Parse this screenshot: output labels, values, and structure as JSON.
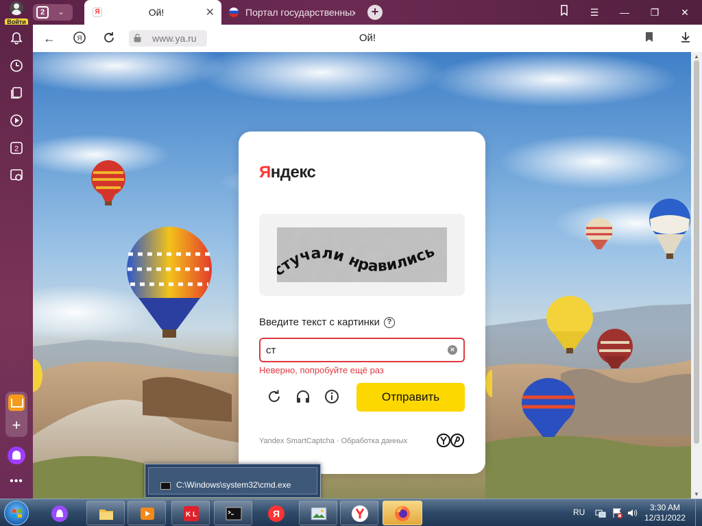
{
  "profile": {
    "login_label": "Войти"
  },
  "tabs": {
    "count": "2",
    "active": {
      "title": "Ой!",
      "favicon_letter": "Я"
    },
    "second": {
      "title": "Портал государственных у"
    }
  },
  "addressbar": {
    "url": "www.ya.ru",
    "page_title": "Ой!"
  },
  "captcha": {
    "brand_first": "Я",
    "brand_rest": "ндекс",
    "image_text": "стучали нравились",
    "prompt": "Введите текст с картинки",
    "help_symbol": "?",
    "input_value": "ст",
    "error": "Неверно, попробуйте ещё раз",
    "submit_label": "Отправить",
    "footer": "Yandex SmartCaptcha · Обработка данных"
  },
  "taskbar": {
    "cmd_tooltip": "C:\\Windows\\system32\\cmd.exe",
    "lang": "RU",
    "time": "3:30 AM",
    "date": "12/31/2022",
    "kl_label": "K L"
  },
  "colors": {
    "accent_yellow": "#fcd700",
    "error_red": "#e0373f",
    "browser_frame": "#6b2a52"
  }
}
